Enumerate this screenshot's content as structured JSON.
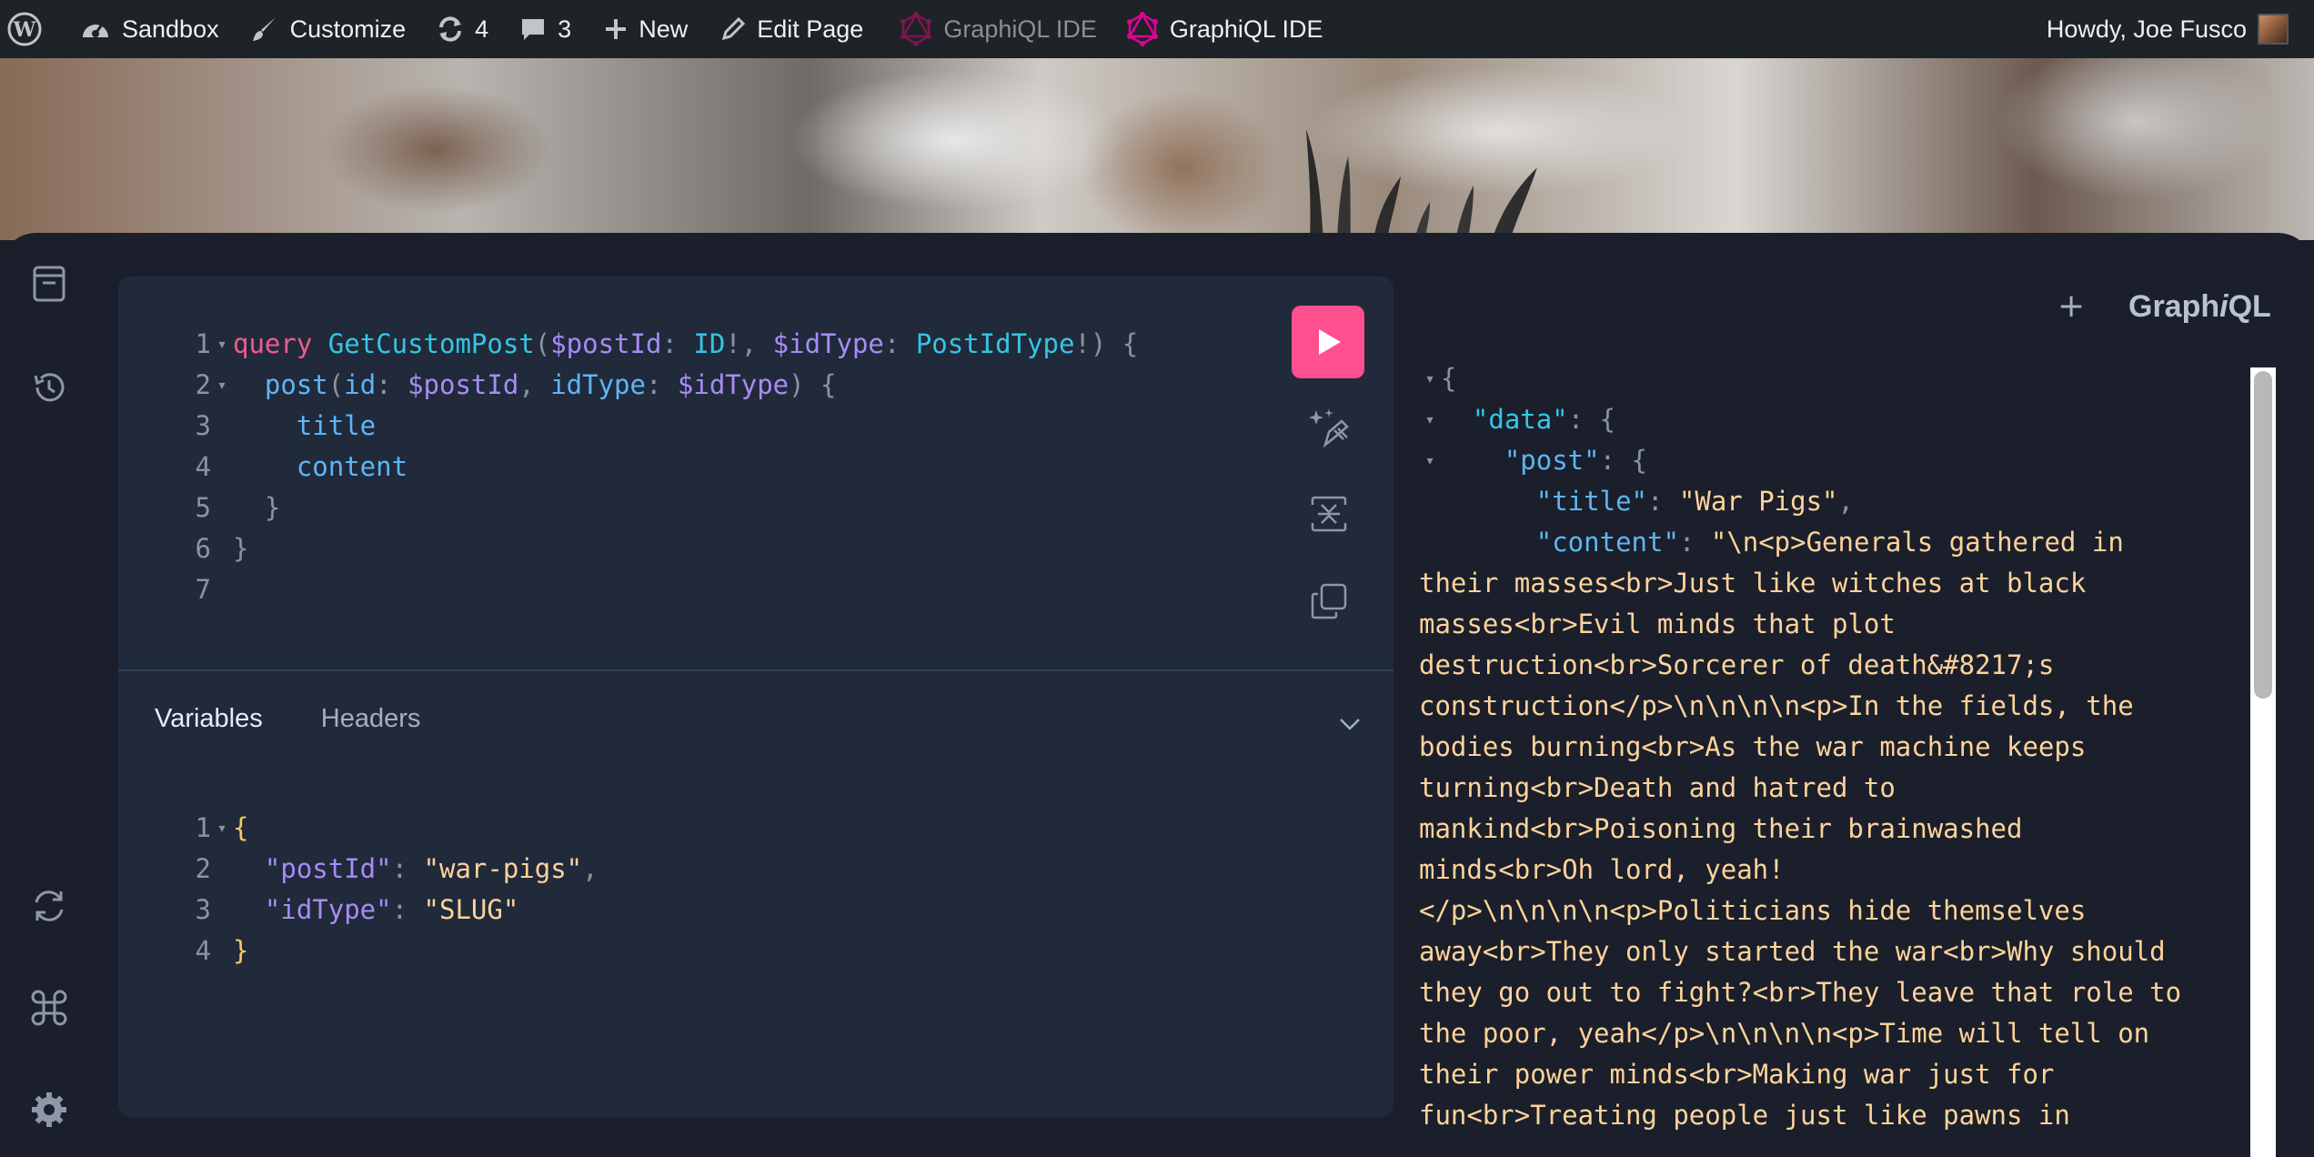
{
  "adminbar": {
    "site_name": "Sandbox",
    "customize": "Customize",
    "updates_count": "4",
    "comments_count": "3",
    "new_label": "New",
    "edit_page": "Edit Page",
    "graphiql_ide_dim": "GraphiQL IDE",
    "graphiql_ide": "GraphiQL IDE",
    "howdy": "Howdy, Joe Fusco"
  },
  "colors": {
    "adminbar_bg": "#1d2327",
    "editor_bg": "#202a3a",
    "run_button": "#ff4f8f",
    "graphql_pink": "#e10098"
  },
  "icons": {
    "sidebar": [
      "docs-icon",
      "history-icon",
      "refetch-schema-icon",
      "shortcuts-icon",
      "settings-icon"
    ],
    "toolbar": [
      "run-icon",
      "prettify-icon",
      "merge-fragments-icon",
      "copy-icon"
    ]
  },
  "query_editor": {
    "lines": [
      {
        "n": "1",
        "fold": "▾",
        "tokens": [
          [
            "query ",
            "kw"
          ],
          [
            "GetCustomPost",
            "def"
          ],
          [
            "(",
            "punc"
          ],
          [
            "$postId",
            "var"
          ],
          [
            ": ",
            "punc"
          ],
          [
            "ID",
            "type"
          ],
          [
            "!",
            "punc"
          ],
          [
            ", ",
            "punc"
          ],
          [
            "$idType",
            "var"
          ],
          [
            ": ",
            "punc"
          ],
          [
            "PostIdType",
            "type"
          ],
          [
            "!",
            "punc"
          ],
          [
            ") {",
            "punc"
          ]
        ]
      },
      {
        "n": "2",
        "fold": "▾",
        "tokens": [
          [
            "  ",
            "punc"
          ],
          [
            "post",
            "fld"
          ],
          [
            "(",
            "punc"
          ],
          [
            "id",
            "fld"
          ],
          [
            ": ",
            "punc"
          ],
          [
            "$postId",
            "var"
          ],
          [
            ", ",
            "punc"
          ],
          [
            "idType",
            "fld"
          ],
          [
            ": ",
            "punc"
          ],
          [
            "$idType",
            "var"
          ],
          [
            ") {",
            "punc"
          ]
        ]
      },
      {
        "n": "3",
        "fold": "",
        "tokens": [
          [
            "    ",
            "punc"
          ],
          [
            "title",
            "fld"
          ]
        ]
      },
      {
        "n": "4",
        "fold": "",
        "tokens": [
          [
            "    ",
            "punc"
          ],
          [
            "content",
            "fld"
          ]
        ]
      },
      {
        "n": "5",
        "fold": "",
        "tokens": [
          [
            "  }",
            "punc"
          ]
        ]
      },
      {
        "n": "6",
        "fold": "",
        "tokens": [
          [
            "}",
            "punc"
          ]
        ]
      },
      {
        "n": "7",
        "fold": "",
        "tokens": []
      }
    ]
  },
  "tabs": {
    "variables": "Variables",
    "headers": "Headers"
  },
  "variables_editor": {
    "lines": [
      {
        "n": "1",
        "fold": "▾",
        "tokens": [
          [
            "{",
            "brace"
          ]
        ]
      },
      {
        "n": "2",
        "fold": "",
        "tokens": [
          [
            "  ",
            "punc"
          ],
          [
            "\"postId\"",
            "key"
          ],
          [
            ": ",
            "punc"
          ],
          [
            "\"war-pigs\"",
            "str"
          ],
          [
            ",",
            "punc"
          ]
        ]
      },
      {
        "n": "3",
        "fold": "",
        "tokens": [
          [
            "  ",
            "punc"
          ],
          [
            "\"idType\"",
            "key"
          ],
          [
            ": ",
            "punc"
          ],
          [
            "\"SLUG\"",
            "str"
          ]
        ]
      },
      {
        "n": "4",
        "fold": "",
        "tokens": [
          [
            "}",
            "brace"
          ]
        ]
      }
    ]
  },
  "result": {
    "logo": {
      "prefix": "Graph",
      "italic": "i",
      "suffix": "QL"
    },
    "plus": "+",
    "lines": [
      {
        "fold": "▾",
        "tokens": [
          [
            "{",
            "punc"
          ]
        ]
      },
      {
        "fold": "▾",
        "tokens": [
          [
            "  ",
            "punc"
          ],
          [
            "\"data\"",
            "def"
          ],
          [
            ": {",
            "punc"
          ]
        ]
      },
      {
        "fold": "▾",
        "tokens": [
          [
            "    ",
            "punc"
          ],
          [
            "\"post\"",
            "fld"
          ],
          [
            ": {",
            "punc"
          ]
        ]
      },
      {
        "fold": "",
        "tokens": [
          [
            "      ",
            "punc"
          ],
          [
            "\"title\"",
            "fld"
          ],
          [
            ": ",
            "punc"
          ],
          [
            "\"War Pigs\"",
            "str"
          ],
          [
            ",",
            "punc"
          ]
        ]
      },
      {
        "fold": "",
        "tokens": [
          [
            "      ",
            "punc"
          ],
          [
            "\"content\"",
            "fld"
          ],
          [
            ": ",
            "punc"
          ],
          [
            "\"\\n<p>Generals gathered in",
            "str"
          ]
        ]
      }
    ],
    "content_wrapped": [
      "their masses<br>Just like witches at black",
      "masses<br>Evil minds that plot",
      "destruction<br>Sorcerer of death&#8217;s",
      "construction</p>\\n\\n\\n\\n<p>In the fields, the",
      "bodies burning<br>As the war machine keeps",
      "turning<br>Death and hatred to",
      "mankind<br>Poisoning their brainwashed",
      "minds<br>Oh lord, yeah!",
      "</p>\\n\\n\\n\\n<p>Politicians hide themselves",
      "away<br>They only started the war<br>Why should",
      "they go out to fight?<br>They leave that role to",
      "the poor, yeah</p>\\n\\n\\n\\n<p>Time will tell on",
      "their power minds<br>Making war just for",
      "fun<br>Treating people just like pawns in"
    ]
  }
}
